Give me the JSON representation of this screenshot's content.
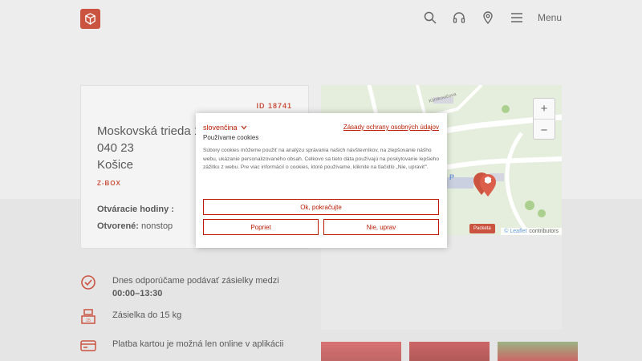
{
  "header": {
    "menu_label": "Menu"
  },
  "location": {
    "id_label": "ID 18741",
    "street": "Moskovská trieda 1",
    "zip": "040 23",
    "city": "Košice",
    "type": "Z-BOX",
    "hours_label": "Otváracie hodiny :",
    "open_label": "Otvorené:",
    "open_value": "nonstop"
  },
  "info": {
    "recommend_prefix": "Dnes odporúčame podávať zásielky medzi ",
    "recommend_time": "00:00–13:30",
    "weight": "Zásielka do 15 kg",
    "payment": "Platba kartou je možná len online v aplikácii"
  },
  "map": {
    "zoom_in": "+",
    "zoom_out": "−",
    "street_label": "Klimkovičova",
    "packeta_badge": "Packeta",
    "leaflet": "© Leaflet",
    "contributors": "contributors"
  },
  "cookie": {
    "language": "slovenčina",
    "privacy_link": "Zásady ochrany osobných údajov",
    "title": "Používame cookies",
    "body": "Súbory cookies môžeme použiť na analýzu správania našich návštevníkov, na zlepšovanie nášho webu, ukázanie personalizovaného obsah. Celkovo sa tieto dáta používajú na poskytovanie lepšieho zážitku z webu. Pre viac informácií o cookies, ktoré používame, kliknite na tlačidlo „Nie, upraviť\".",
    "accept": "Ok, pokračujte",
    "reject": "Popriet",
    "customize": "Nie, uprav"
  },
  "colors": {
    "brand": "#ba1b02"
  }
}
